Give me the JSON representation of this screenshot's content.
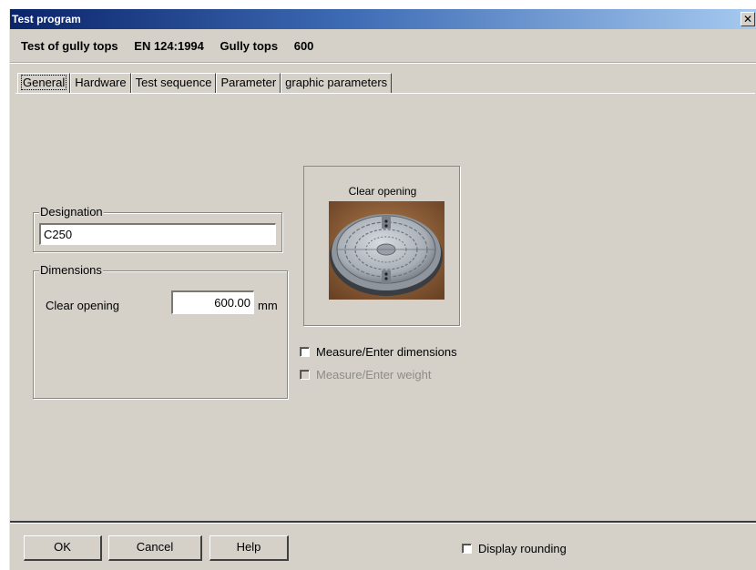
{
  "window": {
    "title": "Test program",
    "close_glyph": "✕"
  },
  "header": {
    "test_name": "Test of gully tops",
    "standard": "EN 124:1994",
    "product": "Gully tops",
    "size": "600"
  },
  "tabs": [
    {
      "label": "General",
      "active": true
    },
    {
      "label": "Hardware",
      "active": false
    },
    {
      "label": "Test sequence",
      "active": false
    },
    {
      "label": "Parameter",
      "active": false
    },
    {
      "label": "graphic parameters",
      "active": false
    }
  ],
  "designation": {
    "legend": "Designation",
    "value": "C250"
  },
  "dimensions": {
    "legend": "Dimensions",
    "clear_opening_label": "Clear opening",
    "clear_opening_value": "600.00",
    "unit": "mm"
  },
  "image_panel": {
    "caption": "Clear opening",
    "image": "manhole-cover-photo"
  },
  "options": {
    "measure_dimensions": {
      "label": "Measure/Enter dimensions",
      "checked": false,
      "enabled": true
    },
    "measure_weight": {
      "label": "Measure/Enter weight",
      "checked": false,
      "enabled": false
    }
  },
  "footer": {
    "ok_label": "OK",
    "cancel_label": "Cancel",
    "help_label": "Help",
    "display_rounding": {
      "label": "Display rounding",
      "checked": false
    }
  },
  "colors": {
    "face": "#d5d1c9",
    "titlebar_start": "#0a246a",
    "titlebar_end": "#a6caf0"
  }
}
